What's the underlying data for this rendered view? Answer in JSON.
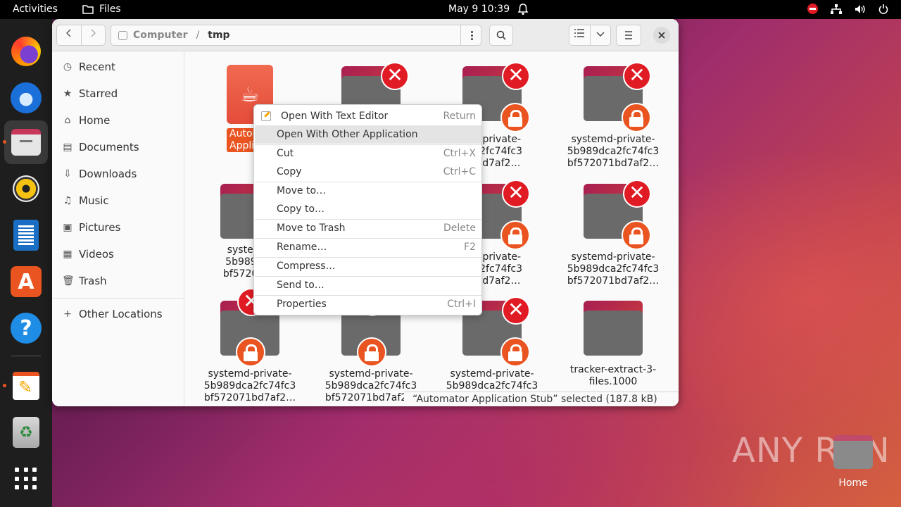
{
  "topbar": {
    "activities": "Activities",
    "app_name": "Files",
    "clock": "May 9  10:39"
  },
  "window": {
    "path": {
      "root": "Computer",
      "current": "tmp"
    },
    "sidebar": {
      "items": [
        {
          "label": "Recent",
          "icon": "clock-icon"
        },
        {
          "label": "Starred",
          "icon": "star-icon"
        },
        {
          "label": "Home",
          "icon": "home-icon"
        },
        {
          "label": "Documents",
          "icon": "document-icon"
        },
        {
          "label": "Downloads",
          "icon": "download-icon"
        },
        {
          "label": "Music",
          "icon": "music-icon"
        },
        {
          "label": "Pictures",
          "icon": "picture-icon"
        },
        {
          "label": "Videos",
          "icon": "video-icon"
        },
        {
          "label": "Trash",
          "icon": "trash-icon"
        }
      ],
      "other_locations": "Other Locations"
    },
    "files": [
      {
        "line1": "Autom",
        "line2": "Applicati"
      },
      {
        "line1": "",
        "line2": ""
      },
      {
        "line1": "md-private-",
        "line2": "dca2fc74fc3",
        "line3": "71bd7af2…"
      },
      {
        "line1": "systemd-private-",
        "line2": "5b989dca2fc74fc3",
        "line3": "bf572071bd7af2…"
      },
      {
        "line1": "systemd-",
        "line2": "5b989dca",
        "line3": "bf572071b"
      },
      {
        "line1": "md-private-",
        "line2": "dca2fc74fc3",
        "line3": "71bd7af2…"
      },
      {
        "line1": "systemd-private-",
        "line2": "5b989dca2fc74fc3",
        "line3": "bf572071bd7af2…"
      },
      {
        "line1": "systemd-private-",
        "line2": "5b989dca2fc74fc3",
        "line3": "bf572071bd7af2…"
      },
      {
        "line1": "systemd-private-",
        "line2": "5b989dca2fc74fc3",
        "line3": "bf572071bd7af2…"
      },
      {
        "line1": "systemd-private-",
        "line2": "5b989dca2fc74fc3",
        "line3": "bf572071bd7af2…"
      },
      {
        "line1": "systemd-private-",
        "line2": "5b989dca2fc74fc3"
      },
      {
        "line1": "tracker-extract-3-",
        "line2": "files.1000"
      }
    ],
    "status": "“Automator Application Stub” selected (187.8 kB)"
  },
  "context_menu": {
    "items": [
      {
        "label": "Open With Text Editor",
        "accel": "Return"
      },
      {
        "label": "Open With Other Application",
        "accel": ""
      },
      {
        "label": "Cut",
        "accel": "Ctrl+X"
      },
      {
        "label": "Copy",
        "accel": "Ctrl+C"
      },
      {
        "label": "Move to…",
        "accel": ""
      },
      {
        "label": "Copy to…",
        "accel": ""
      },
      {
        "label": "Move to Trash",
        "accel": "Delete"
      },
      {
        "label": "Rename…",
        "accel": "F2"
      },
      {
        "label": "Compress…",
        "accel": ""
      },
      {
        "label": "Send to…",
        "accel": ""
      },
      {
        "label": "Properties",
        "accel": "Ctrl+I"
      }
    ]
  },
  "desktop": {
    "home_label": "Home",
    "watermark": "ANY RUN"
  },
  "colors": {
    "accent": "#e95420",
    "emblem_red": "#e01b24"
  }
}
